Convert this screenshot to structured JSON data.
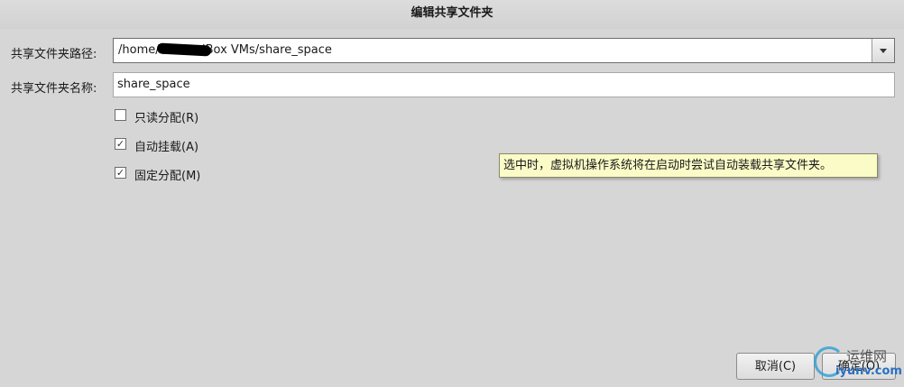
{
  "dialog": {
    "title": "编辑共享文件夹"
  },
  "form": {
    "path_label": "共享文件夹路径:",
    "path_value": "/home/          /VirtualBox VMs/share_space",
    "name_label": "共享文件夹名称:",
    "name_value": "share_space"
  },
  "options": [
    {
      "label": "只读分配(R)",
      "checked": false
    },
    {
      "label": "自动挂载(A)",
      "checked": true
    },
    {
      "label": "固定分配(M)",
      "checked": true
    }
  ],
  "tooltip": "选中时，虚拟机操作系统将在启动时尝试自动装载共享文件夹。",
  "buttons": {
    "cancel": "取消(C)",
    "ok": "确定(O)"
  },
  "watermark": {
    "line1": "运维网",
    "line2": "iyunv.com"
  },
  "icons": {
    "dropdown": "chevron-down-icon",
    "check": "checkmark-icon"
  },
  "colors": {
    "background": "#d6d6d6",
    "tooltip_bg": "#fbfbc7",
    "watermark": "#2b9fd6"
  }
}
